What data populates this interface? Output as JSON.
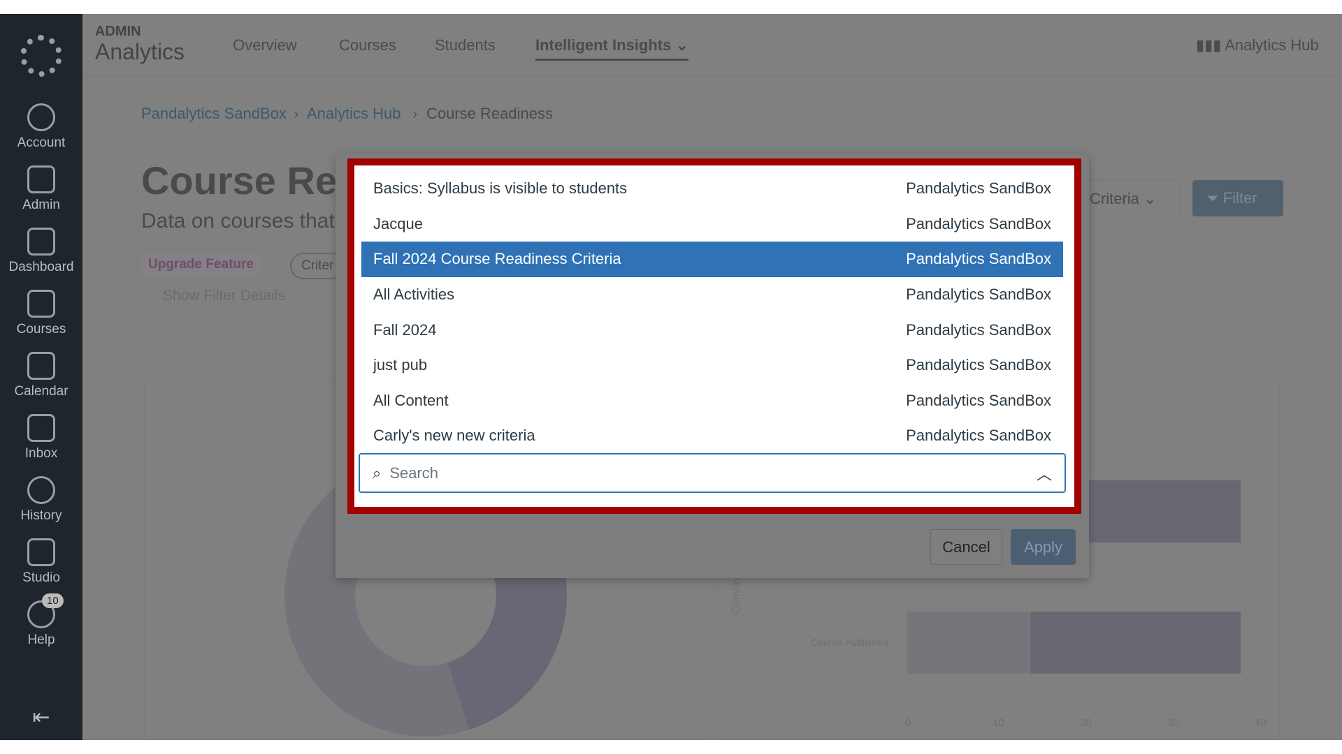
{
  "sidebar": {
    "items": [
      {
        "label": "Account"
      },
      {
        "label": "Admin"
      },
      {
        "label": "Dashboard"
      },
      {
        "label": "Courses"
      },
      {
        "label": "Calendar"
      },
      {
        "label": "Inbox"
      },
      {
        "label": "History"
      },
      {
        "label": "Studio"
      },
      {
        "label": "Help",
        "badge": "10"
      }
    ]
  },
  "header": {
    "eyebrow": "ADMIN",
    "app": "Analytics",
    "tabs": [
      "Overview",
      "Courses",
      "Students",
      "Intelligent Insights"
    ],
    "hub_link": "Analytics Hub"
  },
  "breadcrumb": [
    "Pandalytics SandBox",
    "Analytics Hub",
    "Course Readiness"
  ],
  "page": {
    "title": "Course Rea",
    "subtitle": "Data on courses that",
    "upgrade": "Upgrade Feature",
    "criteria_chip": "Criter",
    "show_filter": "Show Filter Details",
    "criteria_select": "Criteria",
    "filter_btn": "Filter"
  },
  "chart": {
    "y_axis": "Canvas",
    "row_label": "Course Published",
    "ticks": [
      "0",
      "10",
      "20",
      "30",
      "40"
    ]
  },
  "dropdown": {
    "options": [
      {
        "name": "Basics: Syllabus is visible to students",
        "account": "Pandalytics SandBox"
      },
      {
        "name": "Jacque",
        "account": "Pandalytics SandBox"
      },
      {
        "name": "Fall 2024 Course Readiness Criteria",
        "account": "Pandalytics SandBox",
        "selected": true
      },
      {
        "name": "All Activities",
        "account": "Pandalytics SandBox"
      },
      {
        "name": "Fall 2024",
        "account": "Pandalytics SandBox"
      },
      {
        "name": "just pub",
        "account": "Pandalytics SandBox"
      },
      {
        "name": "All Content",
        "account": "Pandalytics SandBox"
      },
      {
        "name": "Carly's new new criteria",
        "account": "Pandalytics SandBox"
      }
    ],
    "search_placeholder": "Search"
  },
  "modal": {
    "cancel": "Cancel",
    "apply": "Apply"
  },
  "colors": {
    "selected": "#2f72b5",
    "highlight_border": "#a30000"
  }
}
